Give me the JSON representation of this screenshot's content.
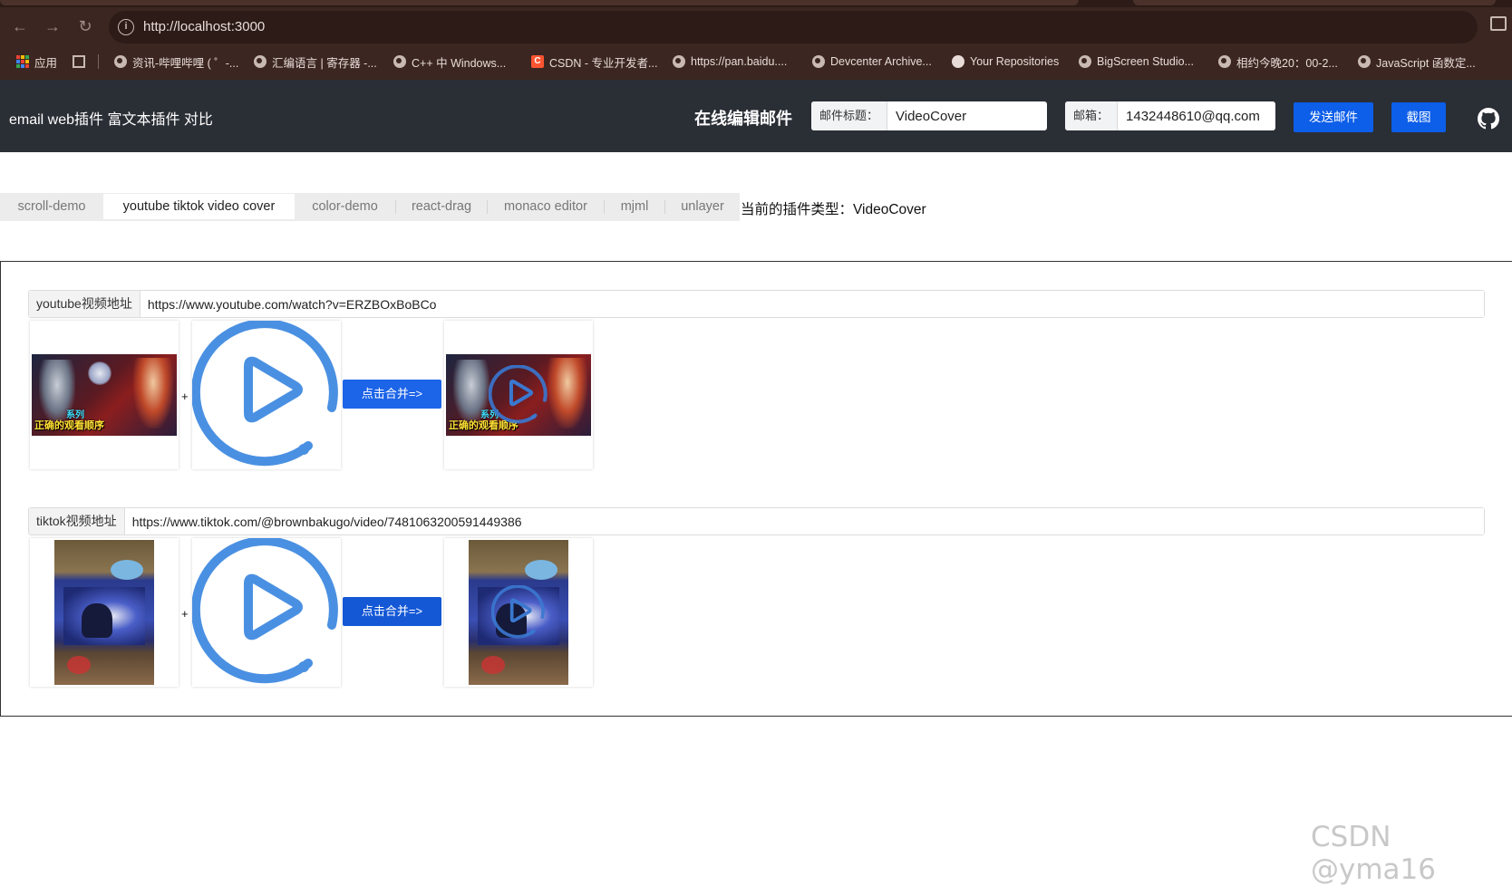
{
  "browser": {
    "url": "http://localhost:3000",
    "bookmarks": [
      {
        "label": "应用",
        "icon": "apps-icon"
      },
      {
        "label": "",
        "icon": "grid-icon"
      },
      {
        "label": "资讯-哔哩哔哩 ( ゜-...",
        "icon": "globe-icon"
      },
      {
        "label": "汇编语言 | 寄存器 -...",
        "icon": "globe-icon"
      },
      {
        "label": "C++ 中 Windows...",
        "icon": "globe-icon"
      },
      {
        "label": "CSDN - 专业开发者...",
        "icon": "csdn-icon"
      },
      {
        "label": "https://pan.baidu....",
        "icon": "globe-icon"
      },
      {
        "label": "Devcenter Archive...",
        "icon": "globe-icon"
      },
      {
        "label": "Your Repositories",
        "icon": "github-icon"
      },
      {
        "label": "BigScreen Studio...",
        "icon": "globe-icon"
      },
      {
        "label": "相约今晚20：00-2...",
        "icon": "globe-icon"
      },
      {
        "label": "JavaScript 函数定...",
        "icon": "globe-icon"
      }
    ]
  },
  "header": {
    "brand": "email web插件 富文本插件 对比",
    "center_title": "在线编辑邮件",
    "subject_label": "邮件标题：",
    "subject_value": "VideoCover",
    "email_label": "邮箱：",
    "email_value": "1432448610@qq.com",
    "send_button": "发送邮件",
    "screenshot_button": "截图"
  },
  "tabs": [
    {
      "label": "scroll-demo",
      "active": false
    },
    {
      "label": "youtube tiktok video cover",
      "active": true
    },
    {
      "label": "color-demo",
      "active": false
    },
    {
      "label": "react-drag",
      "active": false
    },
    {
      "label": "monaco editor",
      "active": false
    },
    {
      "label": "mjml",
      "active": false
    },
    {
      "label": "unlayer",
      "active": false
    }
  ],
  "plugin_type": "当前的插件类型：VideoCover",
  "youtube": {
    "label": "youtube视频地址",
    "url": "https://www.youtube.com/watch?v=ERZBOxBoBCo",
    "plus": "+",
    "merge_button": "点击合并=>",
    "thumb_title": "正确的观看顺序",
    "thumb_sub": "系列"
  },
  "tiktok": {
    "label": "tiktok视频地址",
    "url": "https://www.tiktok.com/@brownbakugo/video/7481063200591449386",
    "plus": "+",
    "merge_button": "点击合并=>"
  },
  "watermark": "CSDN @yma16",
  "colors": {
    "header_bg": "#2a2e35",
    "primary": "#0d5ee9",
    "play_icon": "#4a90e2"
  }
}
